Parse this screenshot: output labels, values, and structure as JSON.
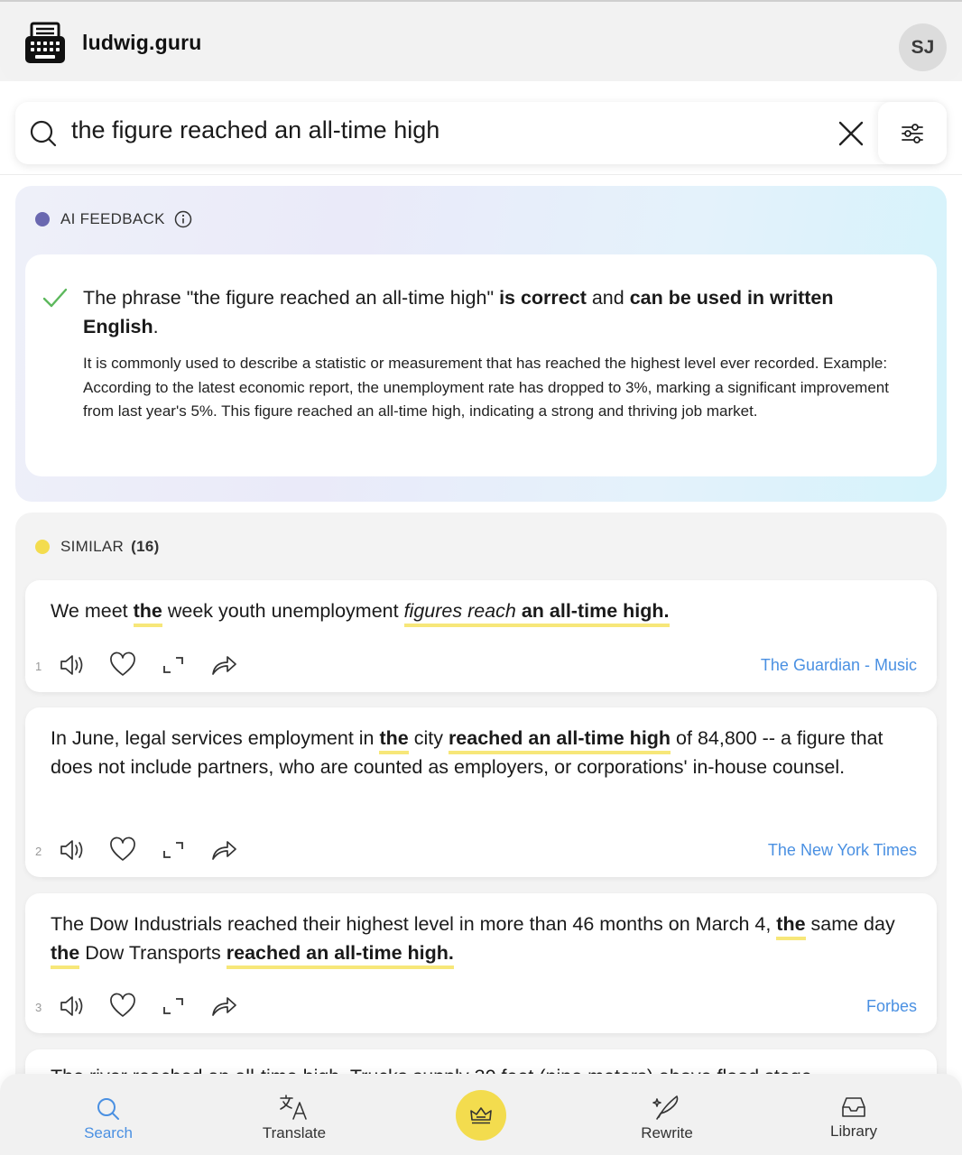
{
  "header": {
    "brand": "ludwig.guru",
    "avatar_initials": "SJ"
  },
  "search": {
    "query": "the figure reached an all-time high",
    "icon": "search-icon",
    "clear_icon": "close-icon",
    "filter_icon": "sliders-icon"
  },
  "ai_feedback": {
    "heading": "AI FEEDBACK",
    "dot_color": "#6a68b0",
    "verdict_icon": "check-icon",
    "verdict": {
      "p1": "The phrase \"the figure reached an all-time high\" ",
      "b1": "is correct",
      "p2": " and ",
      "b2": "can be used in written English",
      "p3": "."
    },
    "detail": "It is commonly used to describe a statistic or measurement that has reached the highest level ever recorded. Example: According to the latest economic report, the unemployment rate has dropped to 3%, marking a significant improvement from last year's 5%. This figure reached an all-time high, indicating a strong and thriving job market."
  },
  "similar": {
    "heading": "SIMILAR",
    "count": "(16)",
    "dot_color": "#f3dc4e",
    "results": [
      {
        "index": "1",
        "parts": [
          "We meet ",
          "the",
          " week youth unemployment ",
          "figures reach",
          " ",
          "an all-time high."
        ],
        "source": "The Guardian - Music"
      },
      {
        "index": "2",
        "parts": [
          "In June, legal services employment in ",
          "the",
          " city ",
          "reached an all-time high",
          " of 84,800 -- a figure that does not include partners, who are counted as employers, or corporations' in-house counsel."
        ],
        "source": "The New York Times"
      },
      {
        "index": "3",
        "parts": [
          "The Dow Industrials reached their highest level in more than 46 months on March 4, ",
          "the",
          " same day ",
          "the",
          " Dow Transports ",
          "reached an all-time high."
        ],
        "source": "Forbes"
      }
    ],
    "peek_text": "The river reached an all-time high. Trucks supply 30 feet (nine meters) above flood stage"
  },
  "actions": {
    "listen_icon": "speaker-icon",
    "like_icon": "heart-icon",
    "expand_icon": "expand-icon",
    "share_icon": "share-icon"
  },
  "nav": {
    "items": [
      {
        "label": "Search",
        "icon": "search-icon"
      },
      {
        "label": "Translate",
        "icon": "translate-icon"
      },
      {
        "label": "Rewrite",
        "icon": "rewrite-icon"
      },
      {
        "label": "Library",
        "icon": "inbox-icon"
      }
    ],
    "premium_icon": "crown-icon",
    "active_color": "#4a90e2"
  }
}
